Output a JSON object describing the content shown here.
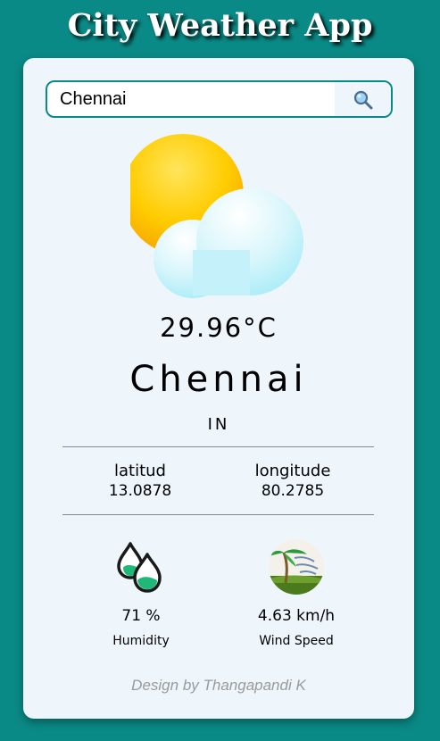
{
  "app": {
    "title": "City Weather App"
  },
  "search": {
    "value": "Chennai",
    "button_icon": "search-icon"
  },
  "weather": {
    "icon": "partly-cloudy-icon",
    "temperature": "29.96°C",
    "city": "Chennai",
    "country": "IN"
  },
  "coordinates": {
    "latitude_label": "latitud",
    "latitude_value": "13.0878",
    "longitude_label": "longitude",
    "longitude_value": "80.2785"
  },
  "stats": {
    "humidity": {
      "value": "71 %",
      "label": "Humidity",
      "icon": "humidity-icon"
    },
    "wind": {
      "value": "4.63 km/h",
      "label": "Wind Speed",
      "icon": "wind-icon"
    }
  },
  "footer": {
    "text": "Design by Thangapandi K"
  },
  "colors": {
    "background": "#0a8a86",
    "card": "#eef6fc",
    "accent": "#0a8a86",
    "footer_text": "#9a9a9a"
  }
}
